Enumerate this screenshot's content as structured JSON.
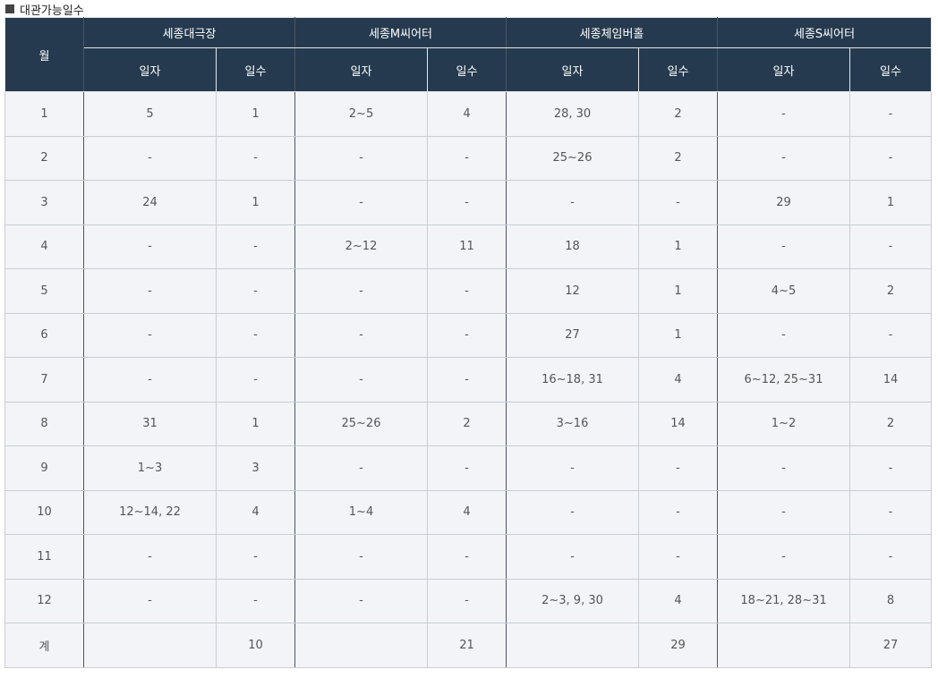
{
  "title": "대관가능일수",
  "table": {
    "month_header": "월",
    "venues": [
      "세종대극장",
      "세종M씨어터",
      "세종체임버홀",
      "세종S씨어터"
    ],
    "sub_headers": [
      "일자",
      "일수"
    ],
    "rows": [
      {
        "month": "1",
        "cells": [
          "5",
          "1",
          "2~5",
          "4",
          "28, 30",
          "2",
          "-",
          "-"
        ]
      },
      {
        "month": "2",
        "cells": [
          "-",
          "-",
          "-",
          "-",
          "25~26",
          "2",
          "-",
          "-"
        ]
      },
      {
        "month": "3",
        "cells": [
          "24",
          "1",
          "-",
          "-",
          "-",
          "-",
          "29",
          "1"
        ]
      },
      {
        "month": "4",
        "cells": [
          "-",
          "-",
          "2~12",
          "11",
          "18",
          "1",
          "-",
          "-"
        ]
      },
      {
        "month": "5",
        "cells": [
          "-",
          "-",
          "-",
          "-",
          "12",
          "1",
          "4~5",
          "2"
        ]
      },
      {
        "month": "6",
        "cells": [
          "-",
          "-",
          "-",
          "-",
          "27",
          "1",
          "-",
          "-"
        ]
      },
      {
        "month": "7",
        "cells": [
          "-",
          "-",
          "-",
          "-",
          "16~18, 31",
          "4",
          "6~12, 25~31",
          "14"
        ]
      },
      {
        "month": "8",
        "cells": [
          "31",
          "1",
          "25~26",
          "2",
          "3~16",
          "14",
          "1~2",
          "2"
        ]
      },
      {
        "month": "9",
        "cells": [
          "1~3",
          "3",
          "-",
          "-",
          "-",
          "-",
          "-",
          "-"
        ]
      },
      {
        "month": "10",
        "cells": [
          "12~14, 22",
          "4",
          "1~4",
          "4",
          "-",
          "-",
          "-",
          "-"
        ]
      },
      {
        "month": "11",
        "cells": [
          "-",
          "-",
          "-",
          "-",
          "-",
          "-",
          "-",
          "-"
        ]
      },
      {
        "month": "12",
        "cells": [
          "-",
          "-",
          "-",
          "-",
          "2~3, 9, 30",
          "4",
          "18~21, 28~31",
          "8"
        ]
      }
    ],
    "total": {
      "label": "계",
      "cells": [
        "",
        "10",
        "",
        "21",
        "",
        "29",
        "",
        "27"
      ]
    }
  }
}
